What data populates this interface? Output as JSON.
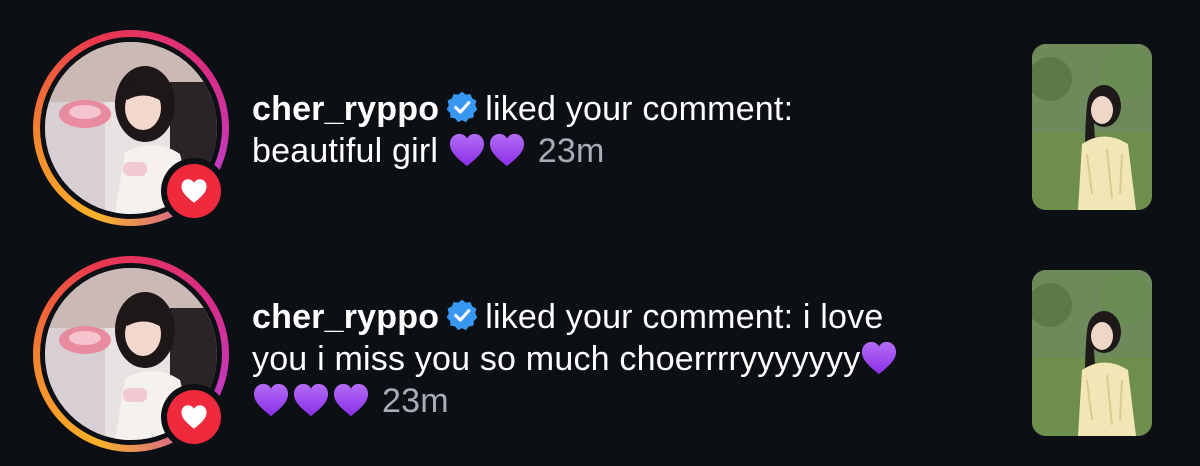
{
  "notifications": [
    {
      "username": "cher_ryppo",
      "verified_icon": "verified-badge-icon",
      "action": "liked your comment:",
      "comment_text": "beautiful girl",
      "comment_trailing_hearts": 2,
      "comment_emoji": "purple-heart",
      "time": "23m",
      "badge_icon": "heart-icon",
      "badge_color": "#ee2a3c"
    },
    {
      "username": "cher_ryppo",
      "verified_icon": "verified-badge-icon",
      "action": "liked your comment: i love",
      "comment_text": "you i miss you so much choerrrryyyyyyy",
      "comment_trailing_hearts": 4,
      "comment_emoji": "purple-heart",
      "time": "23m",
      "badge_icon": "heart-icon",
      "badge_color": "#ee2a3c"
    }
  ],
  "colors": {
    "background": "#0c0f14",
    "text": "#ffffff",
    "timestamp": "#a7adb6",
    "verified": "#3897f0",
    "purple_heart": "#9b3ff0"
  }
}
